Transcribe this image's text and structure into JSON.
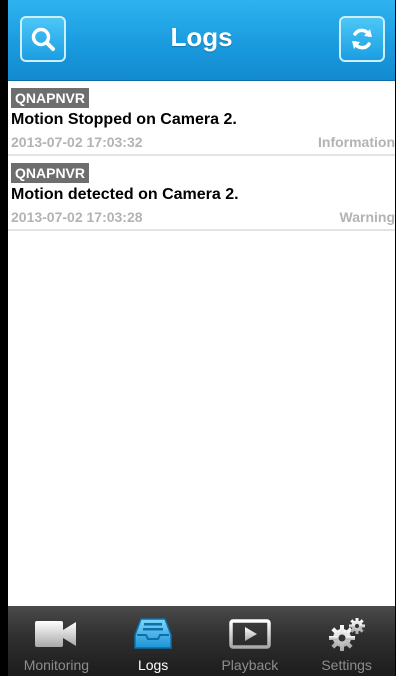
{
  "header": {
    "title": "Logs",
    "search_icon": "search-icon",
    "refresh_icon": "refresh-icon",
    "accent_color": "#1a9bdf"
  },
  "logs": [
    {
      "source": "QNAPNVR",
      "message": "Motion Stopped on Camera 2.",
      "timestamp": "2013-07-02 17:03:32",
      "level": "Information"
    },
    {
      "source": "QNAPNVR",
      "message": "Motion detected on Camera 2.",
      "timestamp": "2013-07-02 17:03:28",
      "level": "Warning"
    }
  ],
  "tabbar": {
    "tabs": [
      {
        "label": "Monitoring",
        "icon": "video-camera-icon",
        "active": false
      },
      {
        "label": "Logs",
        "icon": "inbox-tray-icon",
        "active": true
      },
      {
        "label": "Playback",
        "icon": "play-icon",
        "active": false
      },
      {
        "label": "Settings",
        "icon": "gears-icon",
        "active": false
      }
    ]
  }
}
